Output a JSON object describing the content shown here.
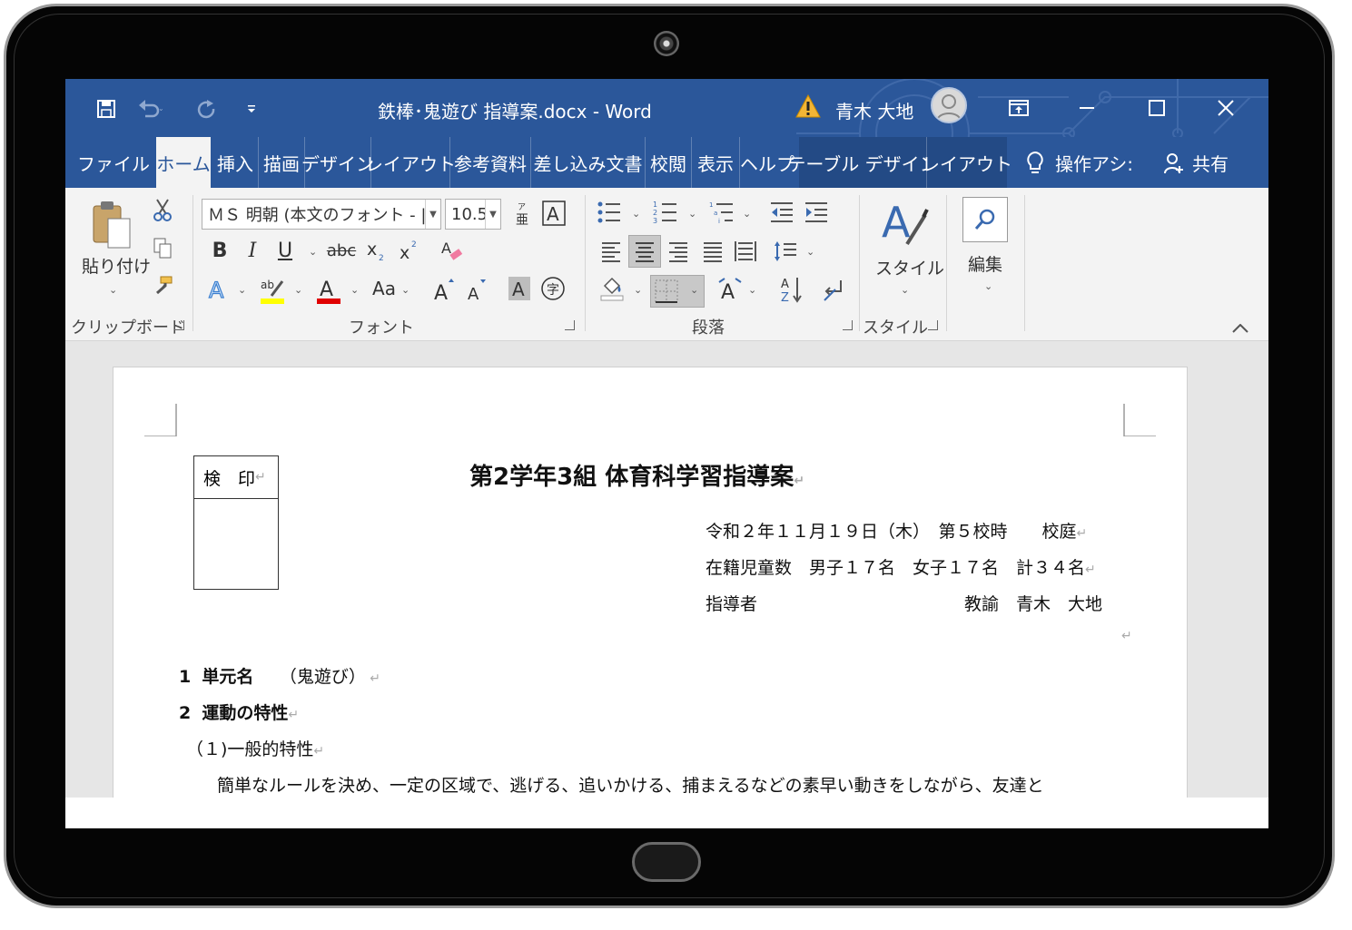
{
  "titlebar": {
    "doc_title": "鉄棒･鬼遊び  指導案.docx  -  Word",
    "user_name": "青木 大地"
  },
  "tabs": [
    {
      "label": "ファイル"
    },
    {
      "label": "ホーム"
    },
    {
      "label": "挿入"
    },
    {
      "label": "描画"
    },
    {
      "label": "デザイン"
    },
    {
      "label": "レイアウト"
    },
    {
      "label": "参考資料"
    },
    {
      "label": "差し込み文書"
    },
    {
      "label": "校閲"
    },
    {
      "label": "表示"
    },
    {
      "label": "ヘルプ"
    },
    {
      "label": "テーブル デザイン"
    },
    {
      "label": "レイアウト"
    },
    {
      "label": "操作アシ:"
    },
    {
      "label": "共有"
    }
  ],
  "ribbon": {
    "clipboard": {
      "paste_label": "貼り付け",
      "group_label": "クリップボード"
    },
    "font": {
      "font_name": "ＭＳ 明朝 (本文のフォント - |",
      "font_size": "10.5",
      "change_case": "Aa",
      "group_label": "フォント"
    },
    "paragraph": {
      "group_label": "段落"
    },
    "styles": {
      "label": "スタイル",
      "group_label": "スタイル"
    },
    "editing": {
      "label": "編集"
    }
  },
  "document": {
    "stamp_header": "検　印",
    "title": "第2学年3組  体育科学習指導案",
    "info_lines": [
      "令和２年１１月１９日（木）　第５校時　　校庭",
      "在籍児童数　男子１７名　女子１７名　計３４名",
      "指導者　　　　　　　　　　　　教諭　青木　大地"
    ],
    "sections": [
      {
        "num": "1",
        "head": "単元名",
        "body": "　　（鬼遊び）"
      },
      {
        "num": "2",
        "head": "運動の特性",
        "body": ""
      }
    ],
    "subsection": "（１)一般的特性",
    "paragraph": "簡単なルールを決め、一定の区域で、逃げる、追いかける、捕まえるなどの素早い動きをしながら、友達と"
  },
  "colors": {
    "accent": "#2b579a",
    "ribbon_bg": "#f3f3f3",
    "doc_bg": "#e6e6e6"
  }
}
